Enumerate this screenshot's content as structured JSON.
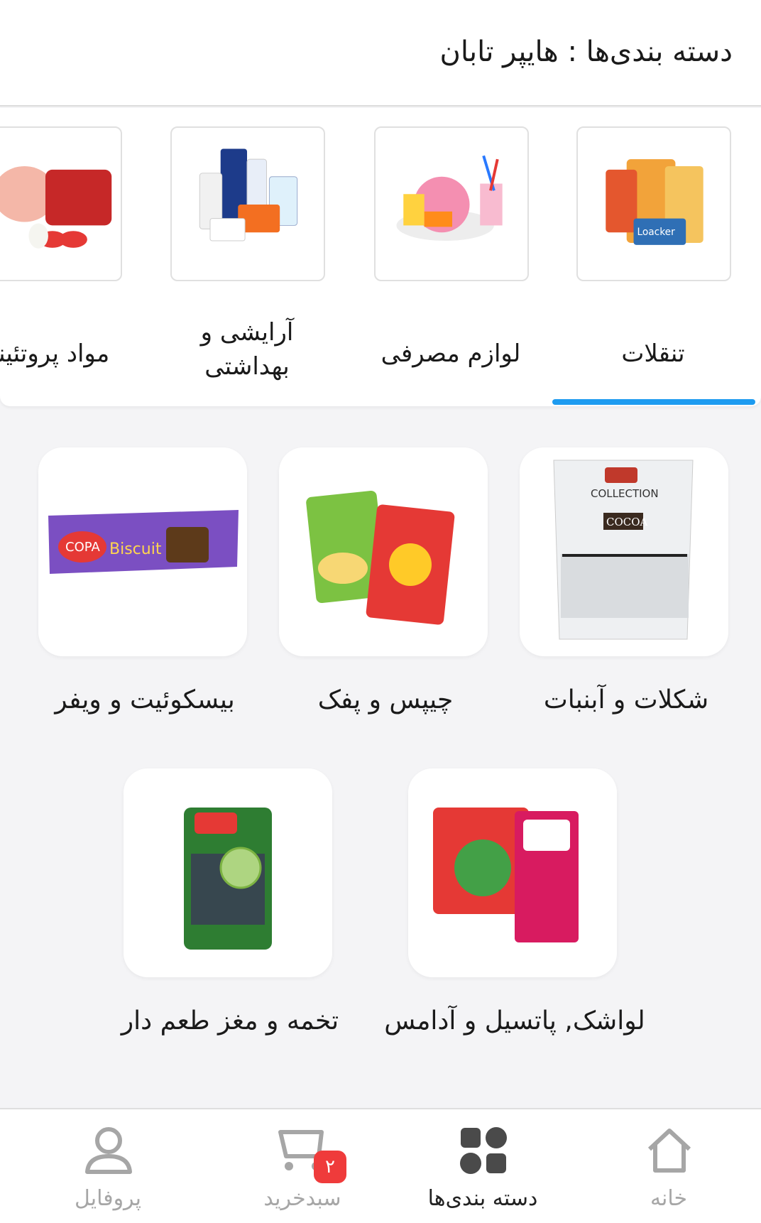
{
  "header": {
    "title": "دسته بندی‌ها  :  هایپر تابان"
  },
  "categories": [
    {
      "label": "تنقلات",
      "icon": "snacks-bundle-image",
      "active": true
    },
    {
      "label": "لوازم مصرفی",
      "icon": "disposable-tableware-image",
      "active": false
    },
    {
      "label": "آرایشی و بهداشتی",
      "icon": "toiletries-image",
      "active": false
    },
    {
      "label": "مواد پروتئینی",
      "icon": "meat-protein-image",
      "active": false
    }
  ],
  "subcategories": [
    {
      "label": "شکلات و آبنبات",
      "icon": "chocolate-candy-image"
    },
    {
      "label": "چیپس و پفک",
      "icon": "chips-puffs-image"
    },
    {
      "label": "بیسکوئیت و ویفر",
      "icon": "biscuit-wafer-image"
    },
    {
      "label": "لواشک, پاتسیل و آدامس",
      "icon": "fruit-leather-gum-image"
    },
    {
      "label": "تخمه و مغز طعم دار",
      "icon": "seeds-nuts-image"
    }
  ],
  "bottom_nav": {
    "home": {
      "label": "خانه",
      "icon": "home-icon"
    },
    "categories": {
      "label": "دسته بندی‌ها",
      "icon": "categories-grid-icon"
    },
    "cart": {
      "label": "سبدخرید",
      "icon": "cart-icon",
      "badge": "۲"
    },
    "profile": {
      "label": "پروفایل",
      "icon": "profile-icon"
    }
  },
  "colors": {
    "accent": "#1d9bf0",
    "badge": "#ef3b3b",
    "inactive": "#a6a6a6"
  }
}
